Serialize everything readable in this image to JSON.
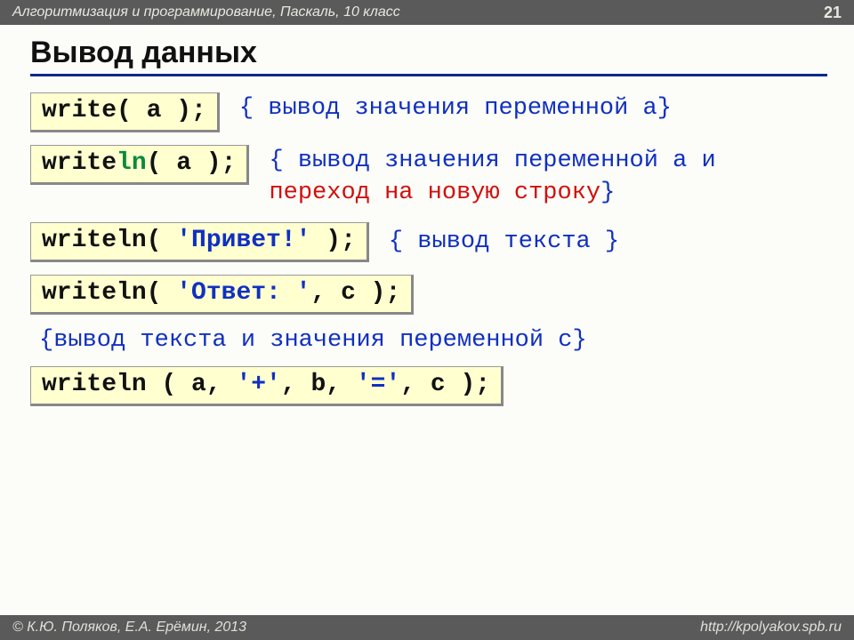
{
  "header": {
    "course": "Алгоритмизация и программирование, Паскаль, 10 класс",
    "page": "21"
  },
  "title": "Вывод данных",
  "rows": [
    {
      "code": {
        "pre": "write( a );"
      },
      "comment": {
        "full": "{ вывод значения переменной a}"
      }
    },
    {
      "code": {
        "pre": "write",
        "green": "ln",
        "post": "( a );"
      },
      "comment": {
        "part1": "{ вывод значения переменной a и ",
        "red": "переход на новую строку",
        "part2": "}"
      }
    },
    {
      "code": {
        "pre": "writeln( ",
        "blue": "'Привет!'",
        "post": " );"
      },
      "comment": {
        "full": "{ вывод текста }"
      }
    },
    {
      "code": {
        "pre": "writeln( ",
        "blue": "'Ответ: '",
        "post": ", c );"
      }
    }
  ],
  "standaloneComment": "{вывод текста и значения переменной c}",
  "lastCode": {
    "pre": "writeln ( a, ",
    "blue1": "'+'",
    "mid": ", b, ",
    "blue2": "'='",
    "post": ", c );"
  },
  "footer": {
    "left": "© К.Ю. Поляков, Е.А. Ерёмин, 2013",
    "right": "http://kpolyakov.spb.ru"
  }
}
